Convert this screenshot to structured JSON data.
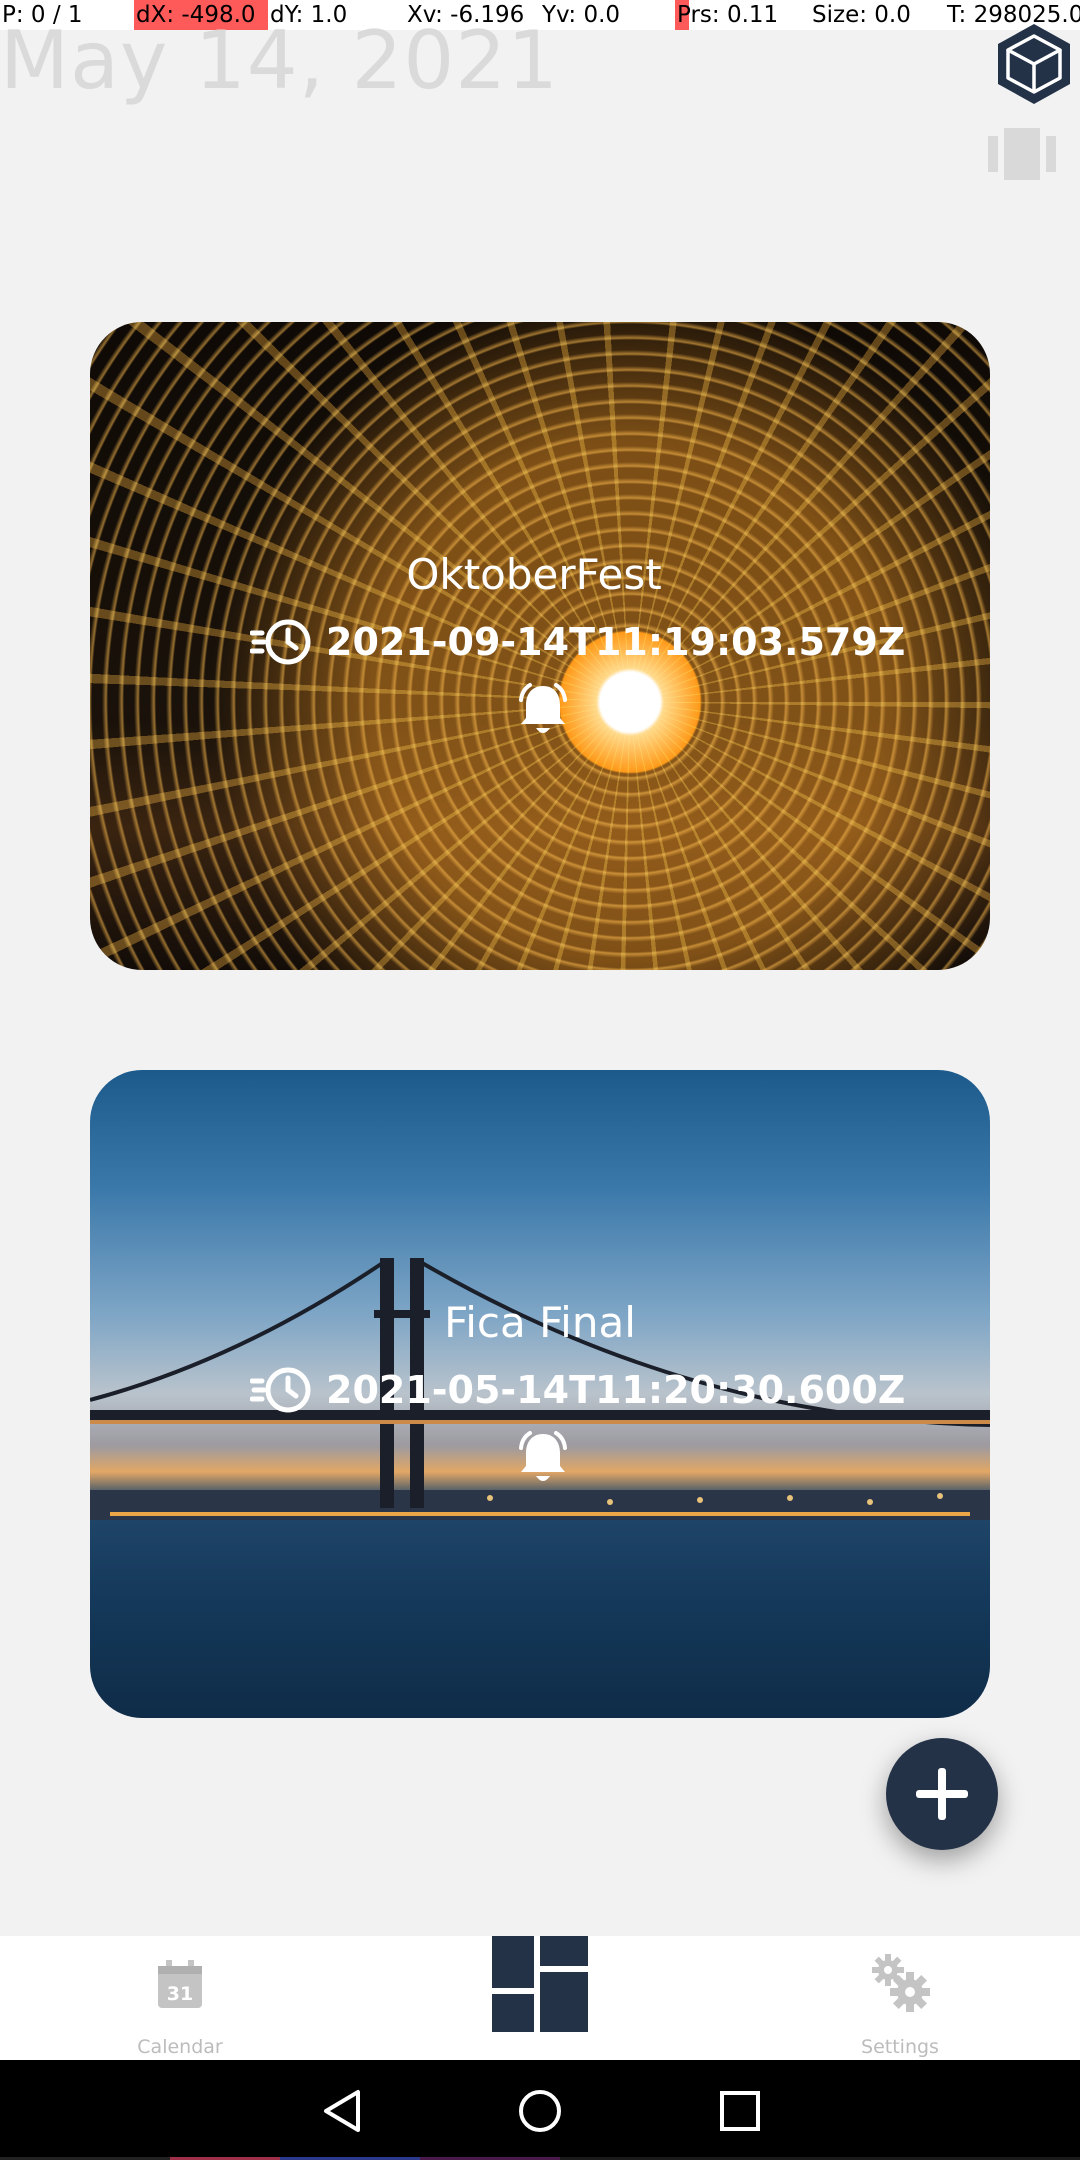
{
  "debug": {
    "pointer": "P: 0 / 1",
    "dx": "dX: -498.0",
    "dy": "dY: 1.0",
    "xv": "Xv: -6.196",
    "yv": "Yv: 0.0",
    "prs": "Prs: 0.11",
    "size": "Size: 0.0",
    "t": "T: 298025.0"
  },
  "header": {
    "date": "May 14, 2021",
    "logo_icon": "cube-icon",
    "view_icon": "carousel-view-icon"
  },
  "events": [
    {
      "title": "OktoberFest",
      "datetime": "2021-09-14T11:19:03.579Z",
      "image": "steel-wool-fire-spiral",
      "time_icon": "clock-fast-icon",
      "alarm_icon": "bell-icon"
    },
    {
      "title": "Fica Final",
      "datetime": "2021-05-14T11:20:30.600Z",
      "image": "bridge-at-dusk",
      "time_icon": "clock-fast-icon",
      "alarm_icon": "bell-icon"
    }
  ],
  "fab": {
    "icon": "plus-icon"
  },
  "bottom_nav": {
    "items": [
      {
        "label": "Calendar",
        "icon": "calendar-icon",
        "badge": "31"
      },
      {
        "label": "",
        "icon": "dashboard-icon",
        "active": true
      },
      {
        "label": "Settings",
        "icon": "gears-icon"
      }
    ]
  },
  "colors": {
    "accent": "#243248",
    "background": "#f2f2f2",
    "inactive": "#bcbcbc"
  },
  "system_nav": {
    "icons": [
      "back-icon",
      "home-icon",
      "recents-icon"
    ]
  }
}
